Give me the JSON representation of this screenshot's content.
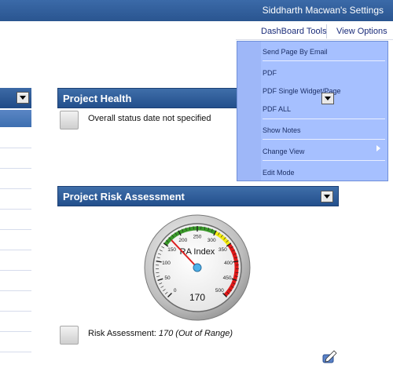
{
  "header": {
    "title": "Siddharth Macwan's Settings"
  },
  "toolbar": {
    "dashboard_tools": "DashBoard Tools",
    "view_options": "View Options"
  },
  "menu": {
    "items": [
      "Send Page By Email",
      "PDF",
      "PDF Single Widget/Page",
      "PDF ALL",
      "Show Notes",
      "Change View",
      "Edit Mode"
    ]
  },
  "project_health": {
    "title": "Project Health",
    "status_text": "Overall status date not specified"
  },
  "risk": {
    "title": "Project Risk Assessment",
    "gauge_label": "RA Index",
    "gauge_value": 170,
    "gauge_value_text": "170",
    "gauge_min": 0,
    "gauge_max": 500,
    "gauge_ticks": [
      "0",
      "50",
      "100",
      "150",
      "200",
      "250",
      "300",
      "350",
      "400",
      "450",
      "500"
    ],
    "assessment_label": "Risk Assessment:",
    "assessment_value": "170 (Out of Range)"
  },
  "colors": {
    "header_blue": "#2a5590",
    "menu_bg": "#a6c0ff",
    "gauge_green": "#3a9a2a",
    "gauge_yellow": "#f2ea10",
    "gauge_red": "#e01818"
  }
}
